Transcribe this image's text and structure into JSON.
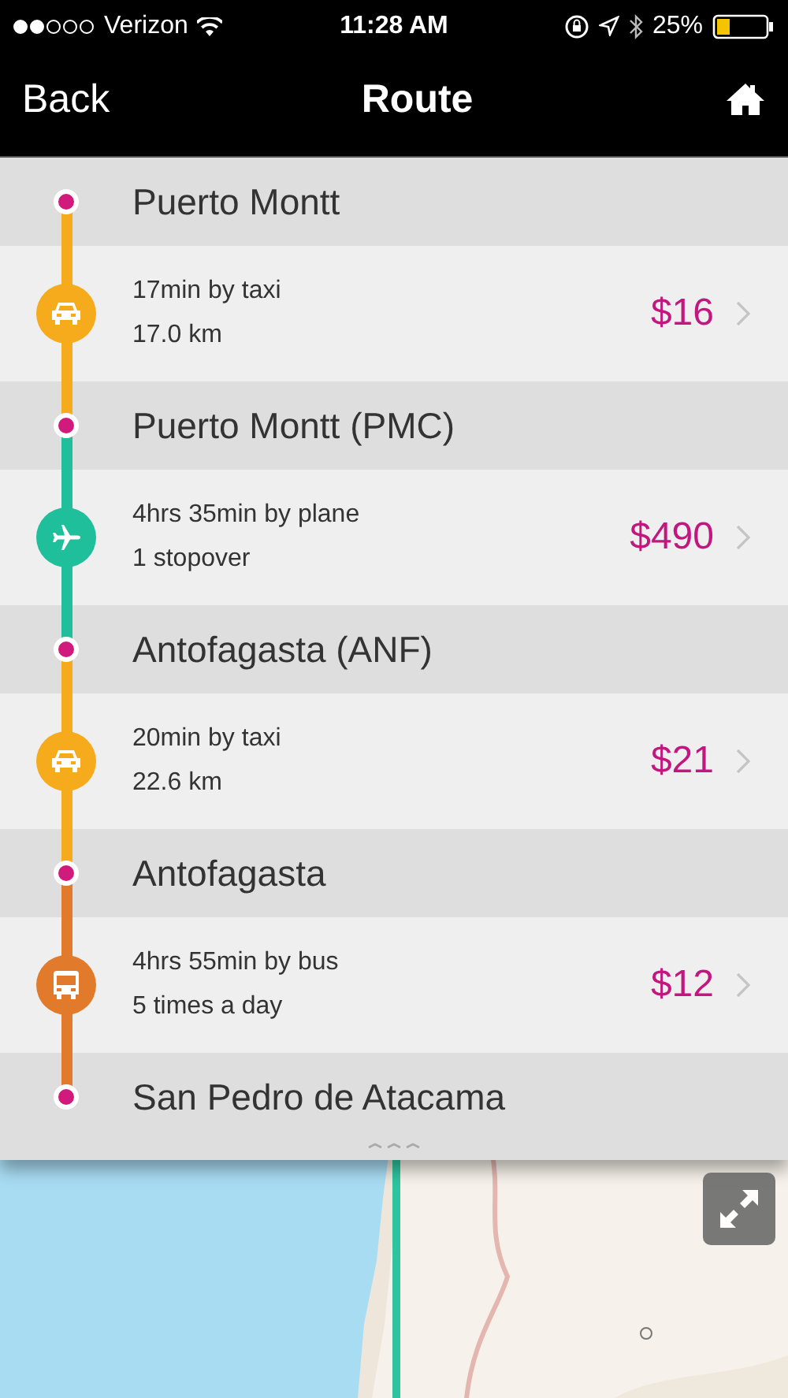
{
  "status_bar": {
    "carrier": "Verizon",
    "time": "11:28 AM",
    "battery": "25%"
  },
  "nav_bar": {
    "back": "Back",
    "title": "Route"
  },
  "route": [
    {
      "kind": "stop",
      "name": "Puerto Montt"
    },
    {
      "kind": "taxi",
      "color": "#f5ab1b",
      "duration": "17min by taxi",
      "detail": "17.0 km",
      "price": "$16"
    },
    {
      "kind": "stop",
      "name": "Puerto Montt (PMC)"
    },
    {
      "kind": "plane",
      "color": "#1fbf9b",
      "duration": "4hrs 35min by plane",
      "detail": "1 stopover",
      "price": "$490"
    },
    {
      "kind": "stop",
      "name": "Antofagasta (ANF)"
    },
    {
      "kind": "taxi",
      "color": "#f5ab1b",
      "duration": "20min by taxi",
      "detail": "22.6 km",
      "price": "$21"
    },
    {
      "kind": "stop",
      "name": "Antofagasta"
    },
    {
      "kind": "bus",
      "color": "#e27a2c",
      "duration": "4hrs 55min by bus",
      "detail": "5 times a day",
      "price": "$12"
    },
    {
      "kind": "stop",
      "name": "San Pedro de Atacama"
    }
  ]
}
